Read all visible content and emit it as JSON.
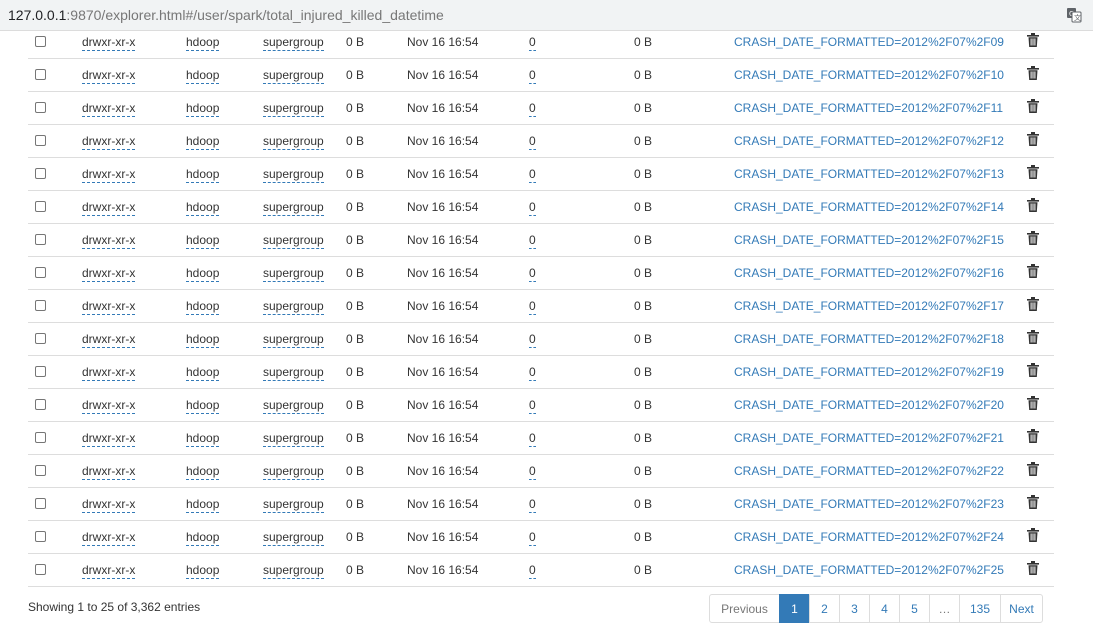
{
  "browser": {
    "url_host": "127.0.0.1",
    "url_rest": ":9870/explorer.html#/user/spark/total_injured_killed_datetime",
    "translate_icon": "translate-icon"
  },
  "table": {
    "rows": [
      {
        "permission": "drwxr-xr-x",
        "owner": "hdoop",
        "group": "supergroup",
        "size": "0 B",
        "last_modified": "Nov 16 16:54",
        "replication": "0",
        "block_size": "0 B",
        "name": "CRASH_DATE_FORMATTED=2012%2F07%2F09"
      },
      {
        "permission": "drwxr-xr-x",
        "owner": "hdoop",
        "group": "supergroup",
        "size": "0 B",
        "last_modified": "Nov 16 16:54",
        "replication": "0",
        "block_size": "0 B",
        "name": "CRASH_DATE_FORMATTED=2012%2F07%2F10"
      },
      {
        "permission": "drwxr-xr-x",
        "owner": "hdoop",
        "group": "supergroup",
        "size": "0 B",
        "last_modified": "Nov 16 16:54",
        "replication": "0",
        "block_size": "0 B",
        "name": "CRASH_DATE_FORMATTED=2012%2F07%2F11"
      },
      {
        "permission": "drwxr-xr-x",
        "owner": "hdoop",
        "group": "supergroup",
        "size": "0 B",
        "last_modified": "Nov 16 16:54",
        "replication": "0",
        "block_size": "0 B",
        "name": "CRASH_DATE_FORMATTED=2012%2F07%2F12"
      },
      {
        "permission": "drwxr-xr-x",
        "owner": "hdoop",
        "group": "supergroup",
        "size": "0 B",
        "last_modified": "Nov 16 16:54",
        "replication": "0",
        "block_size": "0 B",
        "name": "CRASH_DATE_FORMATTED=2012%2F07%2F13"
      },
      {
        "permission": "drwxr-xr-x",
        "owner": "hdoop",
        "group": "supergroup",
        "size": "0 B",
        "last_modified": "Nov 16 16:54",
        "replication": "0",
        "block_size": "0 B",
        "name": "CRASH_DATE_FORMATTED=2012%2F07%2F14"
      },
      {
        "permission": "drwxr-xr-x",
        "owner": "hdoop",
        "group": "supergroup",
        "size": "0 B",
        "last_modified": "Nov 16 16:54",
        "replication": "0",
        "block_size": "0 B",
        "name": "CRASH_DATE_FORMATTED=2012%2F07%2F15"
      },
      {
        "permission": "drwxr-xr-x",
        "owner": "hdoop",
        "group": "supergroup",
        "size": "0 B",
        "last_modified": "Nov 16 16:54",
        "replication": "0",
        "block_size": "0 B",
        "name": "CRASH_DATE_FORMATTED=2012%2F07%2F16"
      },
      {
        "permission": "drwxr-xr-x",
        "owner": "hdoop",
        "group": "supergroup",
        "size": "0 B",
        "last_modified": "Nov 16 16:54",
        "replication": "0",
        "block_size": "0 B",
        "name": "CRASH_DATE_FORMATTED=2012%2F07%2F17"
      },
      {
        "permission": "drwxr-xr-x",
        "owner": "hdoop",
        "group": "supergroup",
        "size": "0 B",
        "last_modified": "Nov 16 16:54",
        "replication": "0",
        "block_size": "0 B",
        "name": "CRASH_DATE_FORMATTED=2012%2F07%2F18"
      },
      {
        "permission": "drwxr-xr-x",
        "owner": "hdoop",
        "group": "supergroup",
        "size": "0 B",
        "last_modified": "Nov 16 16:54",
        "replication": "0",
        "block_size": "0 B",
        "name": "CRASH_DATE_FORMATTED=2012%2F07%2F19"
      },
      {
        "permission": "drwxr-xr-x",
        "owner": "hdoop",
        "group": "supergroup",
        "size": "0 B",
        "last_modified": "Nov 16 16:54",
        "replication": "0",
        "block_size": "0 B",
        "name": "CRASH_DATE_FORMATTED=2012%2F07%2F20"
      },
      {
        "permission": "drwxr-xr-x",
        "owner": "hdoop",
        "group": "supergroup",
        "size": "0 B",
        "last_modified": "Nov 16 16:54",
        "replication": "0",
        "block_size": "0 B",
        "name": "CRASH_DATE_FORMATTED=2012%2F07%2F21"
      },
      {
        "permission": "drwxr-xr-x",
        "owner": "hdoop",
        "group": "supergroup",
        "size": "0 B",
        "last_modified": "Nov 16 16:54",
        "replication": "0",
        "block_size": "0 B",
        "name": "CRASH_DATE_FORMATTED=2012%2F07%2F22"
      },
      {
        "permission": "drwxr-xr-x",
        "owner": "hdoop",
        "group": "supergroup",
        "size": "0 B",
        "last_modified": "Nov 16 16:54",
        "replication": "0",
        "block_size": "0 B",
        "name": "CRASH_DATE_FORMATTED=2012%2F07%2F23"
      },
      {
        "permission": "drwxr-xr-x",
        "owner": "hdoop",
        "group": "supergroup",
        "size": "0 B",
        "last_modified": "Nov 16 16:54",
        "replication": "0",
        "block_size": "0 B",
        "name": "CRASH_DATE_FORMATTED=2012%2F07%2F24"
      },
      {
        "permission": "drwxr-xr-x",
        "owner": "hdoop",
        "group": "supergroup",
        "size": "0 B",
        "last_modified": "Nov 16 16:54",
        "replication": "0",
        "block_size": "0 B",
        "name": "CRASH_DATE_FORMATTED=2012%2F07%2F25"
      }
    ]
  },
  "footer": {
    "info": "Showing 1 to 25 of 3,362 entries"
  },
  "pagination": {
    "items": [
      {
        "label": "Previous",
        "state": "disabled"
      },
      {
        "label": "1",
        "state": "active"
      },
      {
        "label": "2",
        "state": "normal"
      },
      {
        "label": "3",
        "state": "normal"
      },
      {
        "label": "4",
        "state": "normal"
      },
      {
        "label": "5",
        "state": "normal"
      },
      {
        "label": "…",
        "state": "disabled"
      },
      {
        "label": "135",
        "state": "normal"
      },
      {
        "label": "Next",
        "state": "normal"
      }
    ]
  },
  "colors": {
    "link": "#337ab7",
    "active_page": "#337ab7",
    "row_border": "#dddddd"
  }
}
